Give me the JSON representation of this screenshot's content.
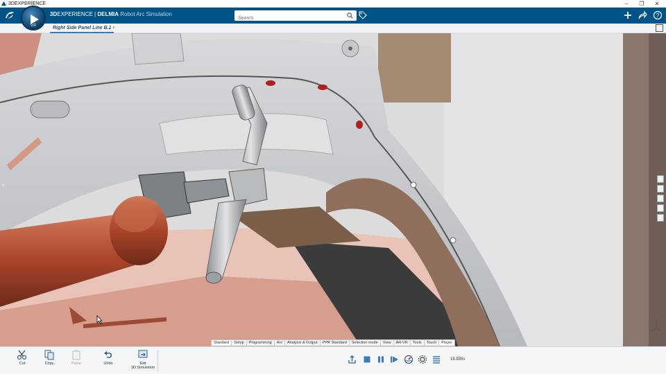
{
  "window": {
    "title": "3DEXPERIENCE",
    "controls": [
      "minimize",
      "restore",
      "close"
    ]
  },
  "header": {
    "brand_bold": "3D",
    "brand_exp": "EXPERIENCE",
    "brand_sep": " | ",
    "brand_app": "DELMIA",
    "brand_module": " Robot Arc Simulation",
    "compass_label": "V,R",
    "search_placeholder": "Search"
  },
  "tabs": [
    {
      "label": "Right Side Panel Line B.1",
      "active": true
    }
  ],
  "workbench_tabs": [
    "Standard",
    "Setup",
    "Programming",
    "Arc",
    "Analysis & Output",
    "PPR Standard",
    "Selection mode",
    "View",
    "AR-VR",
    "Tools",
    "Touch",
    "Player"
  ],
  "active_workbench_tab": "Player",
  "action_bar": {
    "cut": "Cut",
    "copy": "Copy",
    "paste": "Paste",
    "undo": "Undo",
    "exit_line1": "Exit",
    "exit_line2": "3D Simulation"
  },
  "player": {
    "time": "18.935s"
  },
  "colors": {
    "brand_blue": "#005386",
    "robot_orange": "#b4553a",
    "part_grey": "#c9ccd0",
    "accent": "#3b7ab8"
  },
  "icons": [
    "search-icon",
    "tag-icon",
    "plus-icon",
    "share-icon",
    "help-icon",
    "maximize-icon",
    "cut-icon",
    "copy-icon",
    "paste-icon",
    "undo-icon",
    "exit-icon",
    "export-icon",
    "stop-icon",
    "pause-icon",
    "play-icon",
    "speed-icon",
    "settings-icon",
    "list-icon"
  ]
}
